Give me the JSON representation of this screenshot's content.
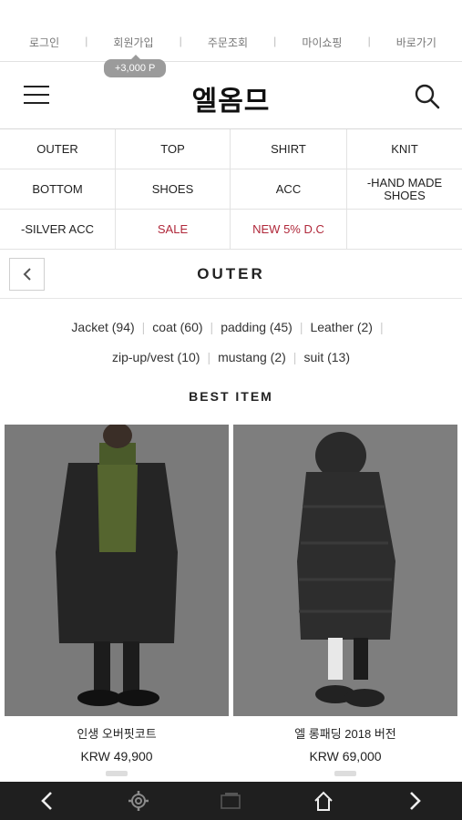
{
  "top_links": [
    "로그인",
    "회원가입",
    "주문조회",
    "마이쇼핑",
    "바로가기"
  ],
  "signup_badge": "+3,000 P",
  "logo": "엘옴므",
  "categories": [
    "OUTER",
    "TOP",
    "SHIRT",
    "KNIT",
    "BOTTOM",
    "SHOES",
    "ACC",
    "-HAND MADE SHOES",
    "-SILVER ACC",
    "SALE",
    "NEW 5% D.C",
    ""
  ],
  "section_title": "OUTER",
  "sub_categories_row1": [
    "Jacket (94)",
    "coat (60)",
    "padding (45)",
    "Leather (2)"
  ],
  "sub_categories_row2": [
    "zip-up/vest (10)",
    "mustang (2)",
    "suit (13)"
  ],
  "best_title": "BEST ITEM",
  "products": [
    {
      "name": "인생 오버핏코트",
      "price": "KRW 49,900"
    },
    {
      "name": "엘 롱패딩 2018 버전",
      "price": "KRW 69,000"
    }
  ],
  "colors": {
    "accent_red": "#b0283a",
    "bottom_bar": "#1f1f1f"
  },
  "bottom_nav_icons": [
    "back-arrow-icon",
    "settings-gear-icon",
    "tabs-icon",
    "home-icon",
    "forward-arrow-icon"
  ]
}
